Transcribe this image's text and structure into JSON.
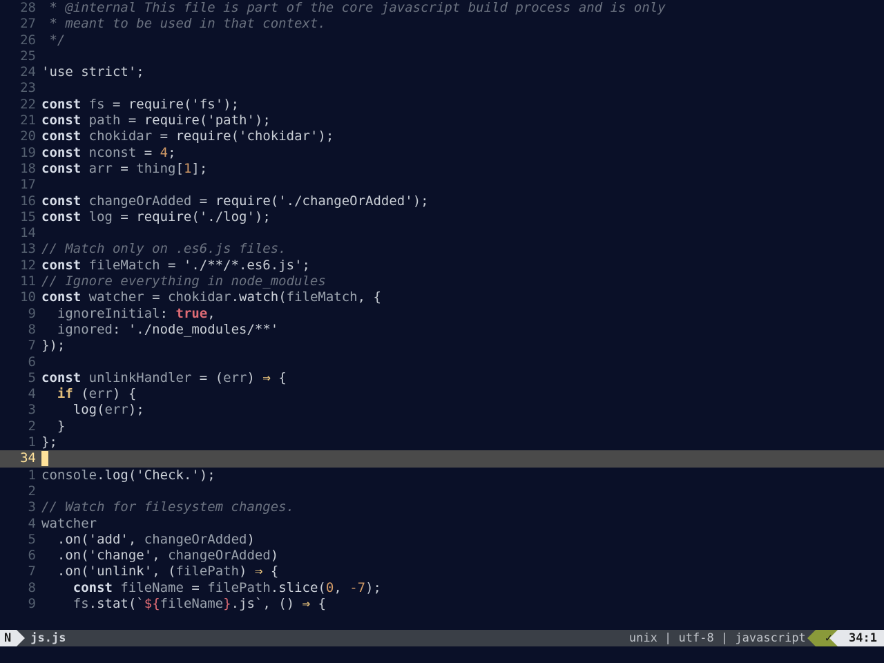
{
  "statusbar": {
    "mode": "N",
    "filename": "js.js",
    "fileformat": "unix",
    "encoding": "utf-8",
    "filetype": "javascript",
    "lint_ok": "✓",
    "position": "34:1",
    "sep": " | "
  },
  "cursor_line_number": "34",
  "lines": [
    {
      "rel": "28",
      "tokens": [
        {
          "c": "cm",
          "t": " * @internal This file is part of the core javascript build process and is only"
        }
      ]
    },
    {
      "rel": "27",
      "tokens": [
        {
          "c": "cm",
          "t": " * meant to be used in that context."
        }
      ]
    },
    {
      "rel": "26",
      "tokens": [
        {
          "c": "cm",
          "t": " */"
        }
      ]
    },
    {
      "rel": "25",
      "tokens": []
    },
    {
      "rel": "24",
      "tokens": [
        {
          "c": "str",
          "t": "'use strict'"
        },
        {
          "c": "pn",
          "t": ";"
        }
      ]
    },
    {
      "rel": "23",
      "tokens": []
    },
    {
      "rel": "22",
      "tokens": [
        {
          "c": "kw",
          "t": "const "
        },
        {
          "c": "id",
          "t": "fs"
        },
        {
          "c": "op",
          "t": " = "
        },
        {
          "c": "fn",
          "t": "require"
        },
        {
          "c": "pn",
          "t": "("
        },
        {
          "c": "str",
          "t": "'fs'"
        },
        {
          "c": "pn",
          "t": ");"
        }
      ]
    },
    {
      "rel": "21",
      "tokens": [
        {
          "c": "kw",
          "t": "const "
        },
        {
          "c": "id",
          "t": "path"
        },
        {
          "c": "op",
          "t": " = "
        },
        {
          "c": "fn",
          "t": "require"
        },
        {
          "c": "pn",
          "t": "("
        },
        {
          "c": "str",
          "t": "'path'"
        },
        {
          "c": "pn",
          "t": ");"
        }
      ]
    },
    {
      "rel": "20",
      "tokens": [
        {
          "c": "kw",
          "t": "const "
        },
        {
          "c": "id",
          "t": "chokidar"
        },
        {
          "c": "op",
          "t": " = "
        },
        {
          "c": "fn",
          "t": "require"
        },
        {
          "c": "pn",
          "t": "("
        },
        {
          "c": "str",
          "t": "'chokidar'"
        },
        {
          "c": "pn",
          "t": ");"
        }
      ]
    },
    {
      "rel": "19",
      "tokens": [
        {
          "c": "kw",
          "t": "const "
        },
        {
          "c": "id",
          "t": "nconst"
        },
        {
          "c": "op",
          "t": " = "
        },
        {
          "c": "num",
          "t": "4"
        },
        {
          "c": "pn",
          "t": ";"
        }
      ]
    },
    {
      "rel": "18",
      "tokens": [
        {
          "c": "kw",
          "t": "const "
        },
        {
          "c": "id",
          "t": "arr"
        },
        {
          "c": "op",
          "t": " = "
        },
        {
          "c": "id",
          "t": "thing"
        },
        {
          "c": "pn",
          "t": "["
        },
        {
          "c": "num",
          "t": "1"
        },
        {
          "c": "pn",
          "t": "];"
        }
      ]
    },
    {
      "rel": "17",
      "tokens": []
    },
    {
      "rel": "16",
      "tokens": [
        {
          "c": "kw",
          "t": "const "
        },
        {
          "c": "id",
          "t": "changeOrAdded"
        },
        {
          "c": "op",
          "t": " = "
        },
        {
          "c": "fn",
          "t": "require"
        },
        {
          "c": "pn",
          "t": "("
        },
        {
          "c": "str",
          "t": "'./changeOrAdded'"
        },
        {
          "c": "pn",
          "t": ");"
        }
      ]
    },
    {
      "rel": "15",
      "tokens": [
        {
          "c": "kw",
          "t": "const "
        },
        {
          "c": "id",
          "t": "log"
        },
        {
          "c": "op",
          "t": " = "
        },
        {
          "c": "fn",
          "t": "require"
        },
        {
          "c": "pn",
          "t": "("
        },
        {
          "c": "str",
          "t": "'./log'"
        },
        {
          "c": "pn",
          "t": ");"
        }
      ]
    },
    {
      "rel": "14",
      "tokens": []
    },
    {
      "rel": "13",
      "tokens": [
        {
          "c": "cm",
          "t": "// Match only on .es6.js files."
        }
      ]
    },
    {
      "rel": "12",
      "tokens": [
        {
          "c": "kw",
          "t": "const "
        },
        {
          "c": "id",
          "t": "fileMatch"
        },
        {
          "c": "op",
          "t": " = "
        },
        {
          "c": "str",
          "t": "'./**/*.es6.js'"
        },
        {
          "c": "pn",
          "t": ";"
        }
      ]
    },
    {
      "rel": "11",
      "tokens": [
        {
          "c": "cm",
          "t": "// Ignore everything in node_modules"
        }
      ]
    },
    {
      "rel": "10",
      "tokens": [
        {
          "c": "kw",
          "t": "const "
        },
        {
          "c": "id",
          "t": "watcher"
        },
        {
          "c": "op",
          "t": " = "
        },
        {
          "c": "id",
          "t": "chokidar"
        },
        {
          "c": "pn",
          "t": "."
        },
        {
          "c": "fn",
          "t": "watch"
        },
        {
          "c": "pn",
          "t": "("
        },
        {
          "c": "id",
          "t": "fileMatch"
        },
        {
          "c": "pn",
          "t": ", {"
        }
      ]
    },
    {
      "rel": "9",
      "tokens": [
        {
          "c": "op",
          "t": "  "
        },
        {
          "c": "id",
          "t": "ignoreInitial"
        },
        {
          "c": "pn",
          "t": ": "
        },
        {
          "c": "bool",
          "t": "true"
        },
        {
          "c": "pn",
          "t": ","
        }
      ]
    },
    {
      "rel": "8",
      "tokens": [
        {
          "c": "op",
          "t": "  "
        },
        {
          "c": "id",
          "t": "ignored"
        },
        {
          "c": "pn",
          "t": ": "
        },
        {
          "c": "str",
          "t": "'./node_modules/**'"
        }
      ]
    },
    {
      "rel": "7",
      "tokens": [
        {
          "c": "pn",
          "t": "});"
        }
      ]
    },
    {
      "rel": "6",
      "tokens": []
    },
    {
      "rel": "5",
      "tokens": [
        {
          "c": "kw",
          "t": "const "
        },
        {
          "c": "id",
          "t": "unlinkHandler"
        },
        {
          "c": "op",
          "t": " = ("
        },
        {
          "c": "id",
          "t": "err"
        },
        {
          "c": "op",
          "t": ") "
        },
        {
          "c": "kw2",
          "t": "⇒"
        },
        {
          "c": "op",
          "t": " {"
        }
      ]
    },
    {
      "rel": "4",
      "tokens": [
        {
          "c": "op",
          "t": "  "
        },
        {
          "c": "kw2",
          "t": "if"
        },
        {
          "c": "op",
          "t": " ("
        },
        {
          "c": "id",
          "t": "err"
        },
        {
          "c": "op",
          "t": ") {"
        }
      ]
    },
    {
      "rel": "3",
      "tokens": [
        {
          "c": "op",
          "t": "    "
        },
        {
          "c": "fn",
          "t": "log"
        },
        {
          "c": "pn",
          "t": "("
        },
        {
          "c": "id",
          "t": "err"
        },
        {
          "c": "pn",
          "t": ");"
        }
      ]
    },
    {
      "rel": "2",
      "tokens": [
        {
          "c": "op",
          "t": "  }"
        }
      ]
    },
    {
      "rel": "1",
      "tokens": [
        {
          "c": "op",
          "t": "};"
        }
      ]
    },
    {
      "rel": "34",
      "current": true,
      "tokens": []
    },
    {
      "rel": "1",
      "tokens": [
        {
          "c": "id",
          "t": "console"
        },
        {
          "c": "pn",
          "t": "."
        },
        {
          "c": "fn",
          "t": "log"
        },
        {
          "c": "pn",
          "t": "("
        },
        {
          "c": "str",
          "t": "'Check.'"
        },
        {
          "c": "pn",
          "t": ");"
        }
      ]
    },
    {
      "rel": "2",
      "tokens": []
    },
    {
      "rel": "3",
      "tokens": [
        {
          "c": "cm",
          "t": "// Watch for filesystem changes."
        }
      ]
    },
    {
      "rel": "4",
      "tokens": [
        {
          "c": "id",
          "t": "watcher"
        }
      ]
    },
    {
      "rel": "5",
      "tokens": [
        {
          "c": "op",
          "t": "  ."
        },
        {
          "c": "fn",
          "t": "on"
        },
        {
          "c": "pn",
          "t": "("
        },
        {
          "c": "str",
          "t": "'add'"
        },
        {
          "c": "pn",
          "t": ", "
        },
        {
          "c": "id",
          "t": "changeOrAdded"
        },
        {
          "c": "pn",
          "t": ")"
        }
      ]
    },
    {
      "rel": "6",
      "tokens": [
        {
          "c": "op",
          "t": "  ."
        },
        {
          "c": "fn",
          "t": "on"
        },
        {
          "c": "pn",
          "t": "("
        },
        {
          "c": "str",
          "t": "'change'"
        },
        {
          "c": "pn",
          "t": ", "
        },
        {
          "c": "id",
          "t": "changeOrAdded"
        },
        {
          "c": "pn",
          "t": ")"
        }
      ]
    },
    {
      "rel": "7",
      "tokens": [
        {
          "c": "op",
          "t": "  ."
        },
        {
          "c": "fn",
          "t": "on"
        },
        {
          "c": "pn",
          "t": "("
        },
        {
          "c": "str",
          "t": "'unlink'"
        },
        {
          "c": "pn",
          "t": ", ("
        },
        {
          "c": "id",
          "t": "filePath"
        },
        {
          "c": "pn",
          "t": ") "
        },
        {
          "c": "kw2",
          "t": "⇒"
        },
        {
          "c": "pn",
          "t": " {"
        }
      ]
    },
    {
      "rel": "8",
      "tokens": [
        {
          "c": "op",
          "t": "    "
        },
        {
          "c": "kw",
          "t": "const "
        },
        {
          "c": "id",
          "t": "fileName"
        },
        {
          "c": "op",
          "t": " = "
        },
        {
          "c": "id",
          "t": "filePath"
        },
        {
          "c": "pn",
          "t": "."
        },
        {
          "c": "fn",
          "t": "slice"
        },
        {
          "c": "pn",
          "t": "("
        },
        {
          "c": "num",
          "t": "0"
        },
        {
          "c": "pn",
          "t": ", "
        },
        {
          "c": "num",
          "t": "-7"
        },
        {
          "c": "pn",
          "t": ");"
        }
      ]
    },
    {
      "rel": "9",
      "tokens": [
        {
          "c": "op",
          "t": "    "
        },
        {
          "c": "id",
          "t": "fs"
        },
        {
          "c": "pn",
          "t": "."
        },
        {
          "c": "fn",
          "t": "stat"
        },
        {
          "c": "pn",
          "t": "("
        },
        {
          "c": "tpl",
          "t": "`"
        },
        {
          "c": "tplv",
          "t": "${"
        },
        {
          "c": "id",
          "t": "fileName"
        },
        {
          "c": "tplv",
          "t": "}"
        },
        {
          "c": "tpl",
          "t": ".js`"
        },
        {
          "c": "pn",
          "t": ", () "
        },
        {
          "c": "kw2",
          "t": "⇒"
        },
        {
          "c": "pn",
          "t": " {"
        }
      ]
    }
  ]
}
